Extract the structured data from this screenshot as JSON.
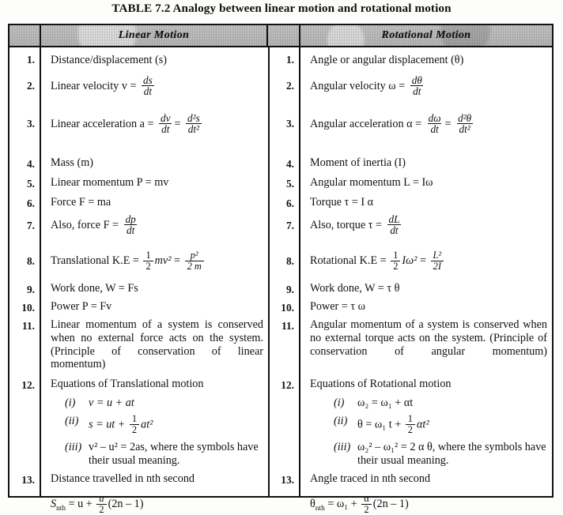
{
  "title": "TABLE 7.2 Analogy between linear motion and rotational motion",
  "header": {
    "linear": "Linear Motion",
    "rotational": "Rotational Motion"
  },
  "numbers": [
    "1.",
    "2.",
    "3.",
    "4.",
    "5.",
    "6.",
    "7.",
    "8.",
    "9.",
    "10.",
    "11.",
    "12.",
    "13."
  ],
  "linear": {
    "r1": "Distance/displacement (s)",
    "r2_label": "Linear velocity v =",
    "r2_num": "ds",
    "r2_den": "dt",
    "r3_label": "Linear acceleration a =",
    "r3_num1": "dv",
    "r3_den1": "dt",
    "r3_num2": "d²s",
    "r3_den2": "dt²",
    "r4": "Mass (m)",
    "r5": "Linear momentum P = mv",
    "r6": "Force F = ma",
    "r7_label": "Also, force F =",
    "r7_num": "dp",
    "r7_den": "dt",
    "r8_label": "Translational K.E =",
    "r8_f1n": "1",
    "r8_f1d": "2",
    "r8_mid": "mv²",
    "r8_f2n": "p²",
    "r8_f2d": "2 m",
    "r9": "Work done, W = Fs",
    "r10": "Power P = Fv",
    "r11": "Linear momentum of a system is conserved when no external force acts on the system. (Principle of conservation of linear momentum)",
    "r12_title": "Equations of Translational motion",
    "r12_i_label": "(i)",
    "r12_i": "v = u + at",
    "r12_ii_label": "(ii)",
    "r12_ii_pre": "s = ut +",
    "r12_ii_fn": "1",
    "r12_ii_fd": "2",
    "r12_ii_post": "at²",
    "r12_iii_label": "(iii)",
    "r12_iii": "v² – u² = 2as, where the symbols have their usual meaning.",
    "r13_title": "Distance travelled in nth second",
    "r13_pre": "S",
    "r13_sub": "nth",
    "r13_mid": "= u +",
    "r13_fn": "a",
    "r13_fd": "2",
    "r13_post": "(2n – 1)"
  },
  "rotational": {
    "r1": "Angle or angular displacement (θ)",
    "r2_label": "Angular velocity ω =",
    "r2_num": "dθ",
    "r2_den": "dt",
    "r3_label": "Angular acceleration α =",
    "r3_num1": "dω",
    "r3_den1": "dt",
    "r3_num2": "d²θ",
    "r3_den2": "dt²",
    "r4": "Moment of inertia (I)",
    "r5": "Angular momentum L = Iω",
    "r6": "Torque τ = I α",
    "r7_label": "Also, torque τ =",
    "r7_num": "dL",
    "r7_den": "dt",
    "r8_label": "Rotational K.E =",
    "r8_f1n": "1",
    "r8_f1d": "2",
    "r8_mid": "Iω²",
    "r8_f2n": "L²",
    "r8_f2d": "2I",
    "r9": "Work done, W = τ θ",
    "r10": "Power = τ ω",
    "r11": "Angular momentum of a system is conserved when no external torque acts on the system. (Principle of conservation of angular momentum)",
    "r12_title": "Equations of Rotational motion",
    "r12_i_label": "(i)",
    "r12_i": "ω₂ = ω₁ + αt",
    "r12_ii_label": "(ii)",
    "r12_ii_pre": "θ = ω₁ t +",
    "r12_ii_fn": "1",
    "r12_ii_fd": "2",
    "r12_ii_post": "αt²",
    "r12_iii_label": "(iii)",
    "r12_iii": "ω₂² – ω₁² = 2 α θ, where the symbols have their usual meaning.",
    "r13_title": "Angle traced in nth second",
    "r13_pre": "θ",
    "r13_sub": "nth",
    "r13_mid": "= ω₁ +",
    "r13_fn": "α",
    "r13_fd": "2",
    "r13_post": "(2n – 1)"
  }
}
